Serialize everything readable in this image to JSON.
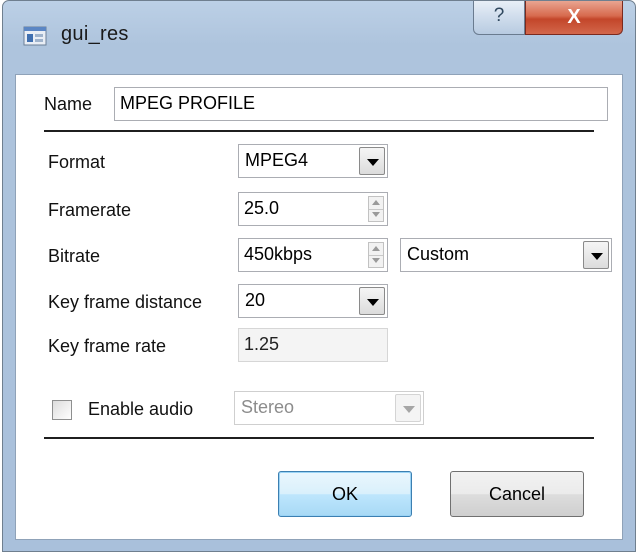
{
  "window": {
    "title": "gui_res",
    "help_symbol": "?",
    "close_symbol": "X"
  },
  "form": {
    "name_label": "Name",
    "name_value": "MPEG PROFILE",
    "format_label": "Format",
    "format_value": "MPEG4",
    "framerate_label": "Framerate",
    "framerate_value": "25.0",
    "bitrate_label": "Bitrate",
    "bitrate_value": "450kbps",
    "bitrate_mode_value": "Custom",
    "keyframe_distance_label": "Key frame distance",
    "keyframe_distance_value": "20",
    "keyframe_rate_label": "Key frame rate",
    "keyframe_rate_value": "1.25",
    "enable_audio_label": "Enable audio",
    "enable_audio_checked": false,
    "audio_mode_value": "Stereo"
  },
  "buttons": {
    "ok_label": "OK",
    "cancel_label": "Cancel"
  },
  "colors": {
    "frame": "#a9c0db",
    "close_button": "#c3462a",
    "default_button_border": "#3c7fb1"
  }
}
